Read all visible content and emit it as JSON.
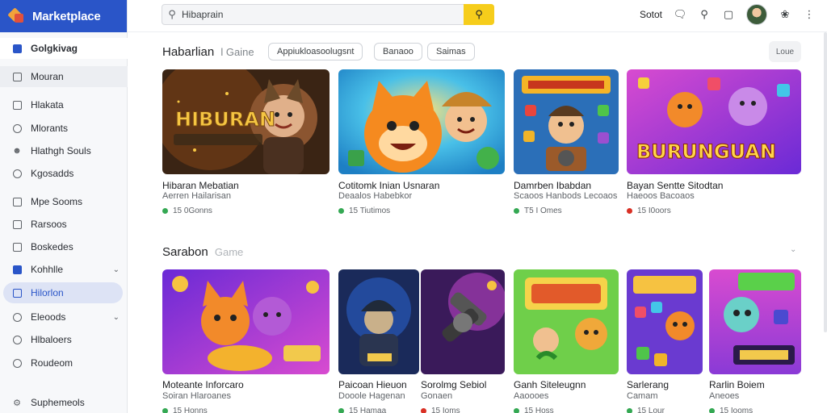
{
  "app": {
    "title": "Marketplace"
  },
  "colors": {
    "brand": "#2a55c8",
    "search_button": "#f6cd1b",
    "status_green": "#34a853",
    "status_red": "#d93025"
  },
  "sidebar": {
    "top_item": "Golgkivag",
    "items": [
      {
        "label": "Mouran",
        "icon": "box-icon"
      },
      {
        "label": "Hlakata",
        "icon": "box-icon"
      },
      {
        "label": "Mlorants",
        "icon": "circle-icon"
      },
      {
        "label": "Hlathgh Souls",
        "icon": "people-icon"
      },
      {
        "label": "Kgosadds",
        "icon": "circle-icon"
      },
      {
        "label": "Mpe Sooms",
        "icon": "box-icon"
      },
      {
        "label": "Rarsoos",
        "icon": "box-icon"
      },
      {
        "label": "Boskedes",
        "icon": "box-icon"
      },
      {
        "label": "Kohhlle",
        "icon": "home-icon"
      },
      {
        "label": "Hilorlon",
        "icon": "box-icon"
      },
      {
        "label": "Eleoods",
        "icon": "circle-icon"
      },
      {
        "label": "Hlbaloers",
        "icon": "circle-icon"
      },
      {
        "label": "Roudeom",
        "icon": "circle-icon"
      },
      {
        "label": "Suphemeols",
        "icon": "gear-icon"
      }
    ]
  },
  "search": {
    "value": "Hibaprain"
  },
  "header": {
    "right_text": "Sotot"
  },
  "section1": {
    "title": "Habarlian",
    "subtitle": "l Gaine",
    "chips": [
      "Appiukloasoolugsnt",
      "Banaoo",
      "Saimas"
    ],
    "more": "Loue",
    "cards": [
      {
        "title": "Hibaran Mebatian",
        "sub": "Aerren Hailarisan",
        "meta": "15 0Gonns",
        "status": "green",
        "art": "HIBURAN"
      },
      {
        "title": "Cotitomk Inian Usnaran",
        "sub": "Deaalos Habebkor",
        "meta": "15 Tiutimos",
        "status": "green",
        "art": ""
      },
      {
        "title": "Damrben Ibabdan",
        "sub": "Scaoos Hanbods Lecoaos",
        "meta": "T5 I Omes",
        "status": "green",
        "art": ""
      },
      {
        "title": "Bayan Sentte Sitodtan",
        "sub": "Haeoos Bacoaos",
        "meta": "15 I0oors",
        "status": "red",
        "art": "BURUNGUAN"
      }
    ]
  },
  "section2": {
    "title": "Sarabon",
    "subtitle": "Game",
    "cards": [
      {
        "title": "Moteante Inforcaro",
        "sub": "Soiran Hlaroanes",
        "meta": "15 Honns",
        "status": "green"
      },
      {
        "title": "Paicoan Hieuon",
        "sub": "Dooole Hagenan",
        "meta": "15 Hamaa",
        "status": "green"
      },
      {
        "title": "Sorolmg Sebiol",
        "sub": "Gonaen",
        "meta": "15 Ioms",
        "status": "red"
      },
      {
        "title": "Ganh Siteleugnn",
        "sub": "Aaoooes",
        "meta": "15 Hoss",
        "status": "green"
      },
      {
        "title": "Sarlerang",
        "sub": "Camam",
        "meta": "15 Lour",
        "status": "green"
      },
      {
        "title": "Rarlin Boiem",
        "sub": "Aneoes",
        "meta": "15 Iooms",
        "status": "green"
      }
    ]
  }
}
